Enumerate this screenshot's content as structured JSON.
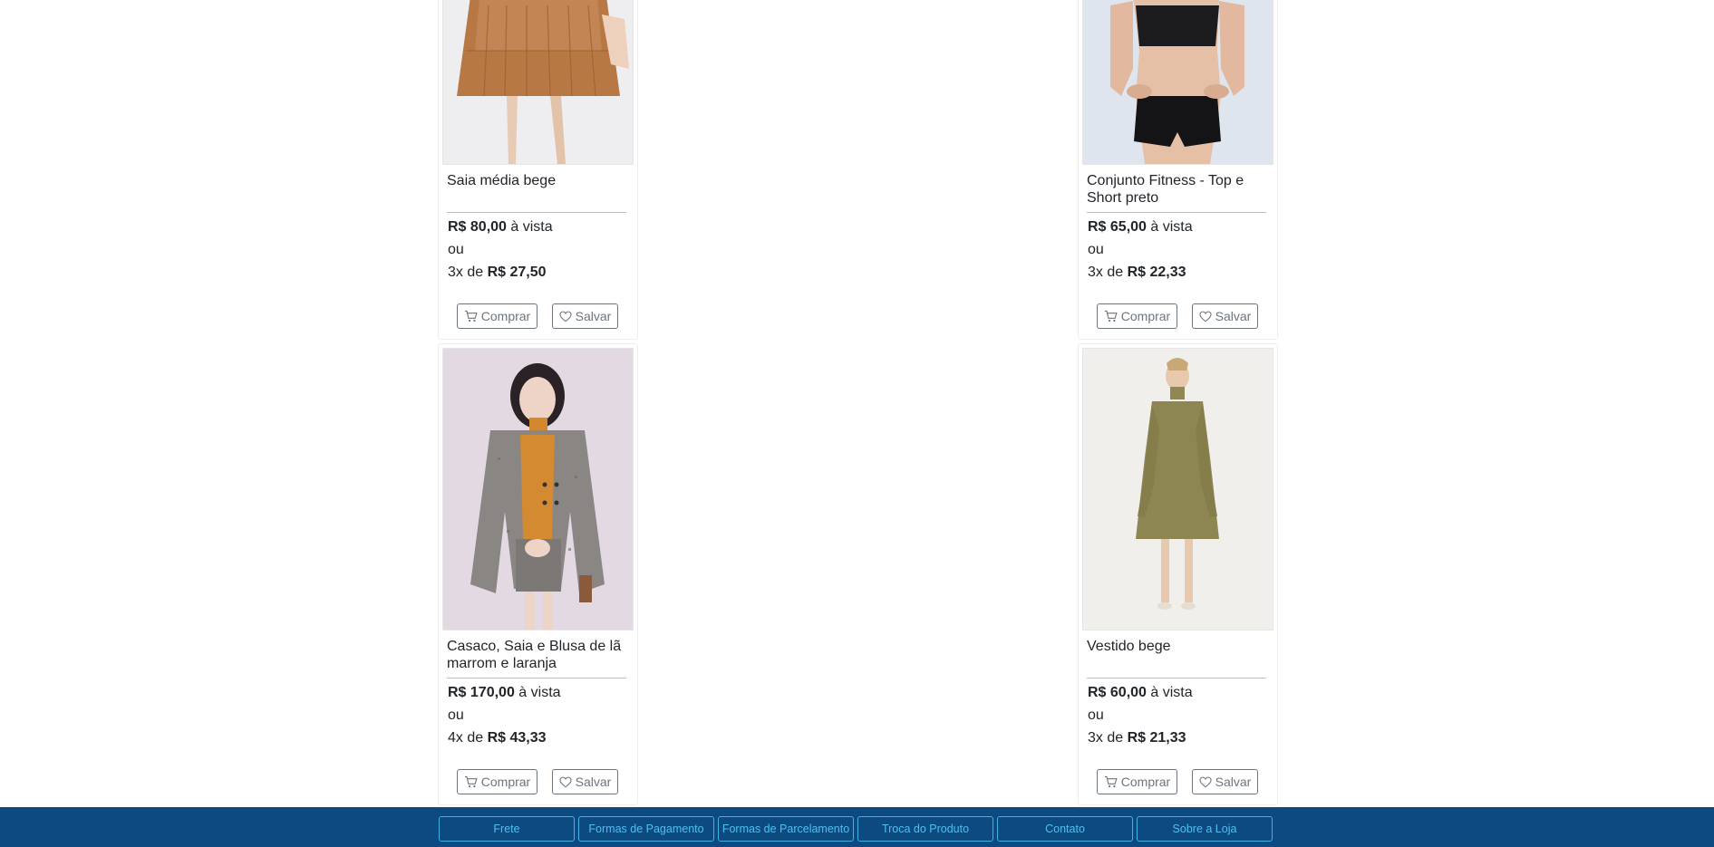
{
  "products": [
    {
      "name": "Saia média bege",
      "price_cash": "R$ 80,00",
      "cash_label": "à vista",
      "or_label": "ou",
      "installments": "3x de",
      "installment_value": "R$ 27,50",
      "buy_label": "Comprar",
      "save_label": "Salvar"
    },
    {
      "name": "Conjunto Fitness - Top e Short preto",
      "price_cash": "R$ 65,00",
      "cash_label": "à vista",
      "or_label": "ou",
      "installments": "3x de",
      "installment_value": "R$ 22,33",
      "buy_label": "Comprar",
      "save_label": "Salvar"
    },
    {
      "name": "Casaco, Saia e Blusa de lã marrom e laranja",
      "price_cash": "R$ 170,00",
      "cash_label": "à vista",
      "or_label": "ou",
      "installments": "4x de",
      "installment_value": "R$ 43,33",
      "buy_label": "Comprar",
      "save_label": "Salvar"
    },
    {
      "name": "Vestido bege",
      "price_cash": "R$ 60,00",
      "cash_label": "à vista",
      "or_label": "ou",
      "installments": "3x de",
      "installment_value": "R$ 21,33",
      "buy_label": "Comprar",
      "save_label": "Salvar"
    }
  ],
  "footer": {
    "links": [
      "Frete",
      "Formas de Pagamento",
      "Formas de Parcelamento",
      "Troca do Produto",
      "Contato",
      "Sobre a Loja"
    ]
  },
  "colors": {
    "footer_bg": "#0d4a7f",
    "footer_link": "#4cc0f0",
    "button_border": "#6c757d"
  },
  "icons": {
    "buy": "cart-icon",
    "save": "heart-icon"
  }
}
